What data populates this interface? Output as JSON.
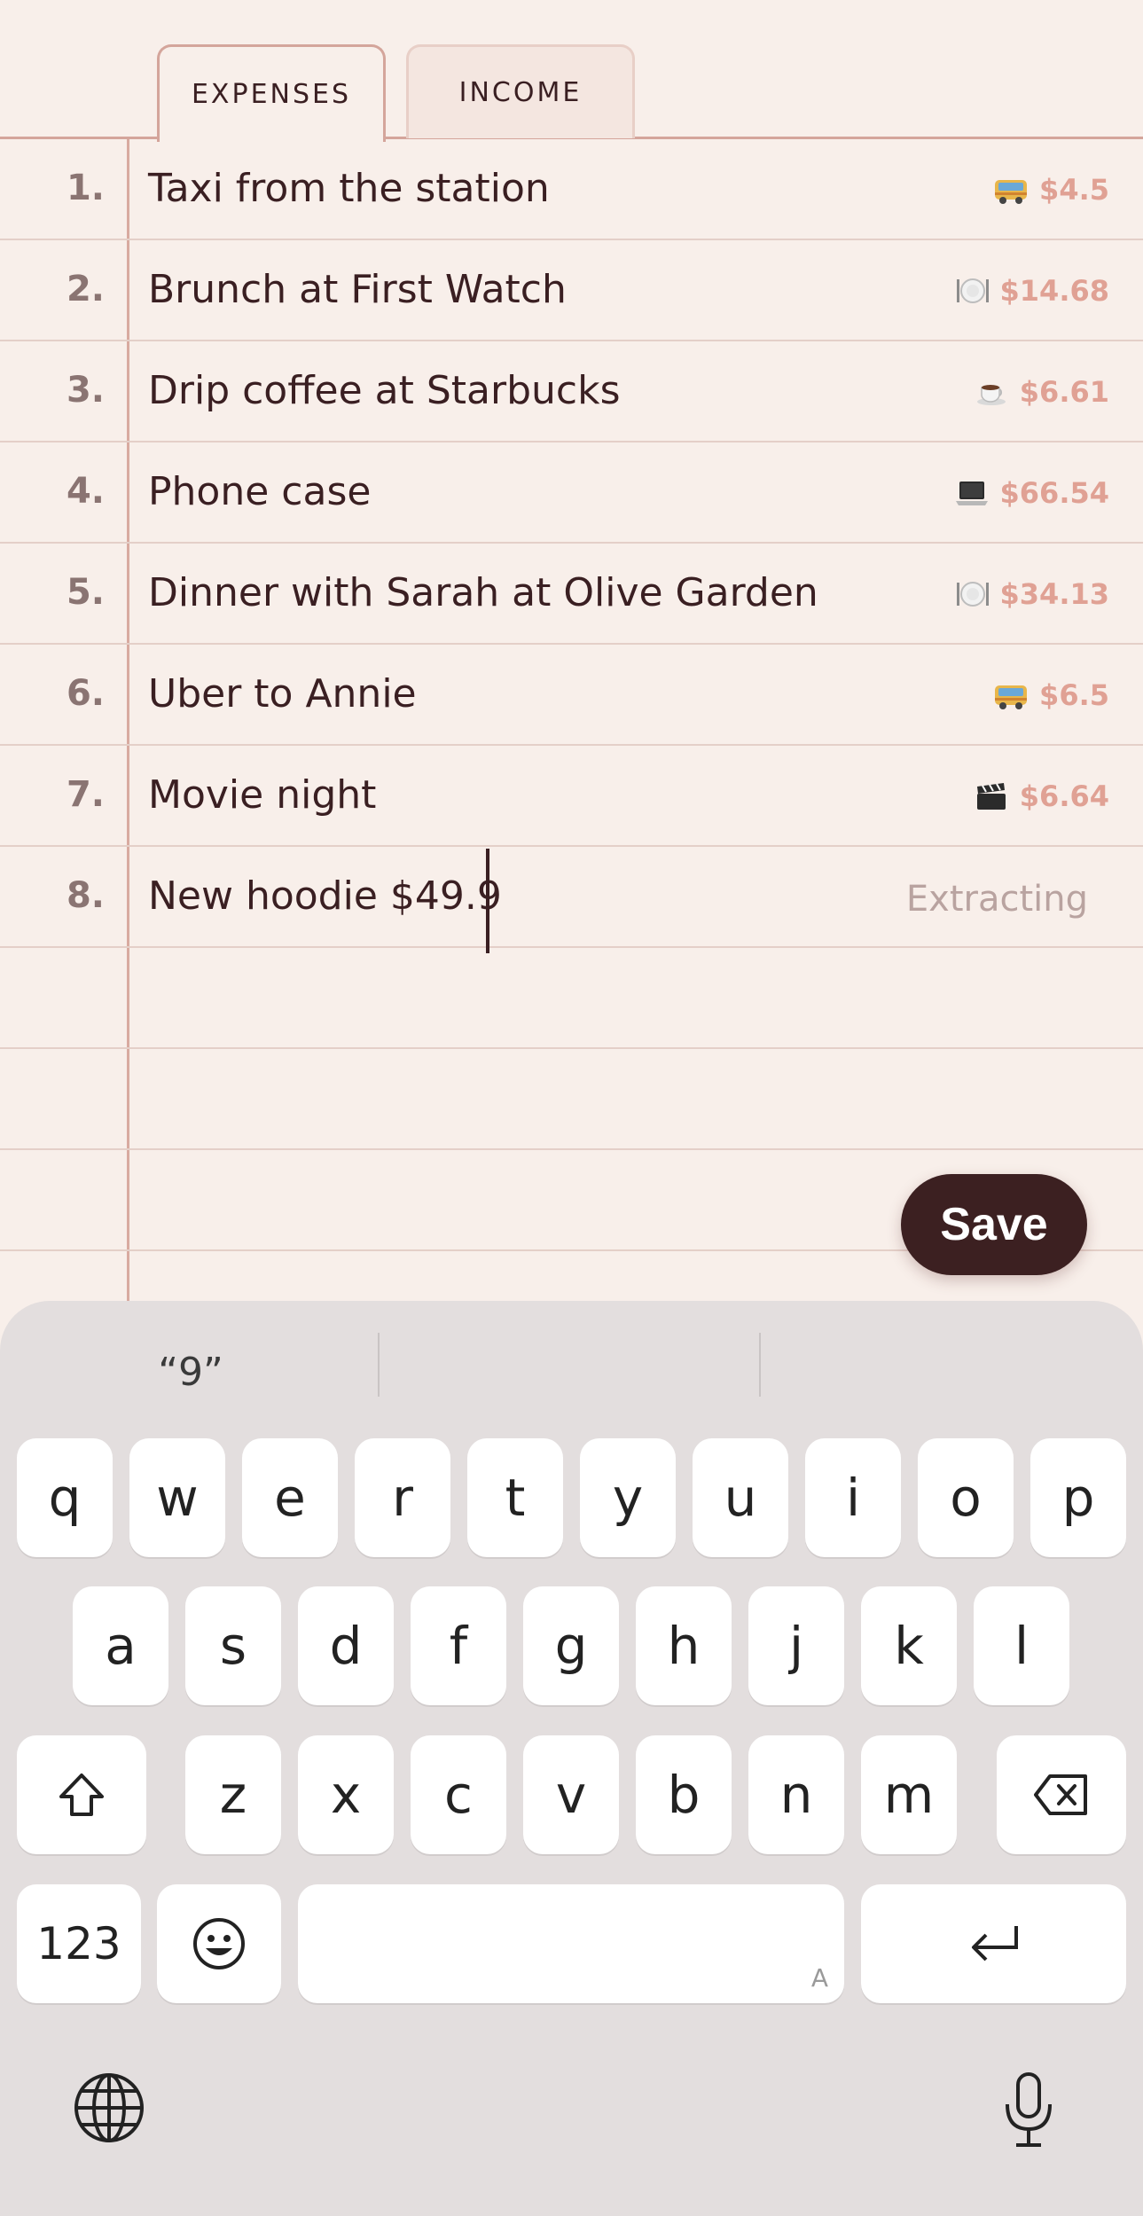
{
  "tabs": [
    {
      "label": "EXPENSES",
      "active": true
    },
    {
      "label": "INCOME",
      "active": false
    }
  ],
  "rows": [
    {
      "num": "1.",
      "text": "Taxi from the station",
      "icon": "bus-icon",
      "amount": "$4.5"
    },
    {
      "num": "2.",
      "text": "Brunch at First Watch",
      "icon": "plate-icon",
      "amount": "$14.68"
    },
    {
      "num": "3.",
      "text": "Drip coffee at Starbucks",
      "icon": "coffee-icon",
      "amount": "$6.61"
    },
    {
      "num": "4.",
      "text": "Phone case",
      "icon": "laptop-icon",
      "amount": "$66.54"
    },
    {
      "num": "5.",
      "text": "Dinner with Sarah at Olive Garden",
      "icon": "plate-icon",
      "amount": "$34.13"
    },
    {
      "num": "6.",
      "text": "Uber to Annie",
      "icon": "bus-icon",
      "amount": "$6.5"
    },
    {
      "num": "7.",
      "text": "Movie night",
      "icon": "clapper-icon",
      "amount": "$6.64"
    },
    {
      "num": "8.",
      "text": "New hoodie $49.9",
      "status": "Extracting"
    }
  ],
  "save_label": "Save",
  "keyboard": {
    "suggestions": [
      "“9”",
      "",
      ""
    ],
    "row1": [
      "q",
      "w",
      "e",
      "r",
      "t",
      "y",
      "u",
      "i",
      "o",
      "p"
    ],
    "row2": [
      "a",
      "s",
      "d",
      "f",
      "g",
      "h",
      "j",
      "k",
      "l"
    ],
    "row3": [
      "z",
      "x",
      "c",
      "v",
      "b",
      "n",
      "m"
    ],
    "numbers_label": "123",
    "space_hint": "A",
    "colors": {
      "background": "#e3dede",
      "key": "#ffffff"
    }
  },
  "colors": {
    "paper": "#f8efea",
    "accent": "#e0a194",
    "ink": "#3a1f22",
    "save_bg": "#3c2021"
  }
}
